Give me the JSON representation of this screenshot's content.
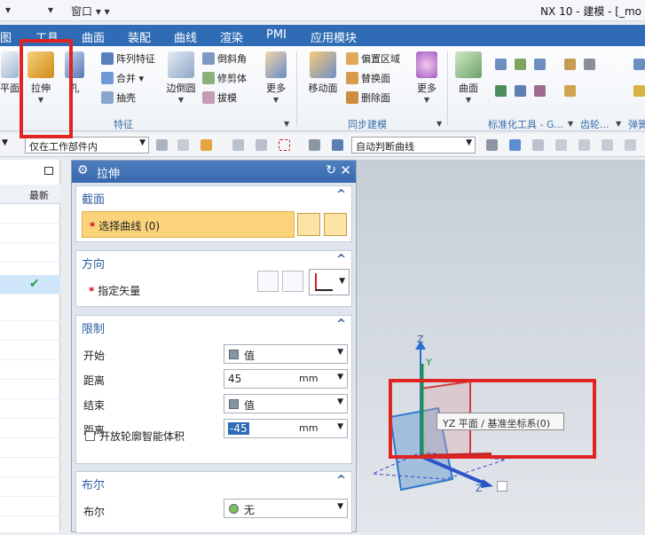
{
  "titlebar": {
    "quick_access": [
      "▾",
      "▾",
      "窗口 ▾ ▾"
    ],
    "app_title": "NX 10 - 建模 - [_mo"
  },
  "menu": {
    "tabs": [
      "图",
      "工具",
      "曲面",
      "装配",
      "曲线",
      "渲染",
      "PMI",
      "应用模块"
    ]
  },
  "ribbon": {
    "big_buttons": [
      "平面",
      "拉伸",
      "孔",
      "边倒圆",
      "更多",
      "移动面",
      "更多",
      "曲面"
    ],
    "small_buttons": [
      "阵列特征",
      "合并 ▾",
      "抽壳",
      "倒斜角",
      "修剪体",
      "拔模",
      "偏置区域",
      "替换面",
      "删除面"
    ],
    "groups": [
      "特征",
      "同步建模",
      "标准化工具 - G...",
      "齿轮...",
      "弹簧"
    ]
  },
  "selbar": {
    "filter_combo": "仅在工作部件内",
    "curve_rule_combo": "自动判断曲线"
  },
  "navigator": {
    "column_header": "最新",
    "checkmark": "✔"
  },
  "dialog": {
    "title": "拉伸",
    "sections": {
      "section": {
        "title": "截面",
        "select_curve": "选择曲线 (0)"
      },
      "direction": {
        "title": "方向",
        "vector_label": "指定矢量"
      },
      "limits": {
        "title": "限制",
        "start_label": "开始",
        "start_value": "值",
        "start_distance_label": "距离",
        "start_distance": "45",
        "start_unit": "mm",
        "end_label": "结束",
        "end_value": "值",
        "end_distance_label": "距离",
        "end_distance": "-45",
        "end_unit": "mm",
        "open_profile": "开放轮廓智能体积"
      },
      "boolean": {
        "title": "布尔",
        "label": "布尔",
        "value": "无"
      }
    }
  },
  "graphics": {
    "axis_z_top": "Z",
    "axis_y": "Y",
    "axis_z_bottom": "Z",
    "tooltip": "YZ 平面 / 基准坐标系(0)"
  },
  "colors": {
    "accent": "#2f6cb5",
    "highlight": "#e02323",
    "select_row": "#fbd37a"
  }
}
